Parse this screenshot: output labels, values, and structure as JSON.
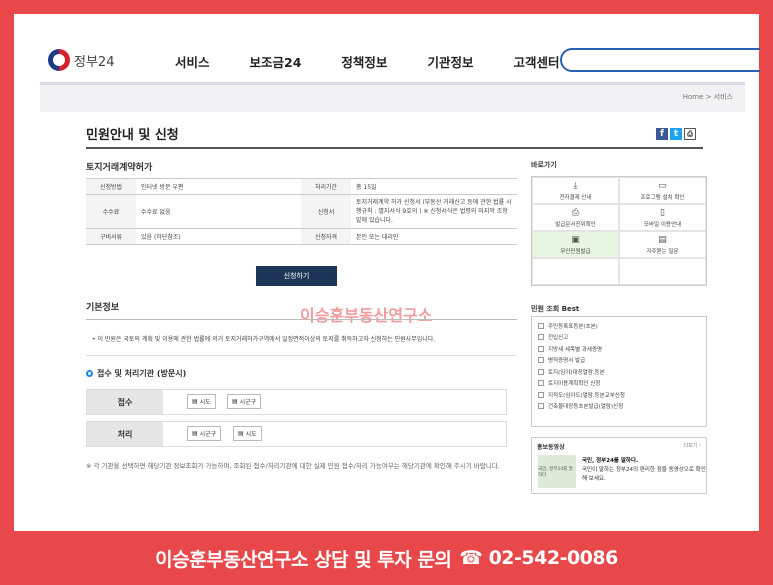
{
  "header": {
    "logo_text": "정부24",
    "nav": [
      "서비스",
      "보조금24",
      "정책정보",
      "기관정보",
      "고객센터"
    ],
    "breadcrumb": "Home > 서비스"
  },
  "page_title": "민원안내 및 신청",
  "social": {
    "fb": "f",
    "tw": "t",
    "print": "⎙"
  },
  "section": {
    "title": "토지거래계약허가",
    "table": [
      {
        "k1": "신청방법",
        "v1": "인터넷 방문 우편",
        "k2": "처리기간",
        "v2": "총 15일"
      },
      {
        "k1": "수수료",
        "v1": "수수료 없음",
        "k2": "신청서",
        "v2": "토지거래계약 허가 신청서 (부동산 거래신고 등에 관한 법률 시행규칙 : 별지서식 9호의 ) ※ 신청서식은 법령의 마지막 조항 밑에 있습니다."
      },
      {
        "k1": "구비서류",
        "v1": "있음 (하단참조)",
        "k2": "신청자격",
        "v2": "본인 또는 대리인"
      }
    ],
    "apply_button": "신청하기"
  },
  "basic_info": {
    "title": "기본정보",
    "text": "이 민원은 국토의 계획 및 이용에 관한 법률에 의거 토지거래허가구역에서 일정면적이상의 토지를 취득하고자 신청하는 민원사무입니다."
  },
  "watermark": "이승훈부동산연구소",
  "office": {
    "title": "접수 및 처리기관 (방문시)",
    "rows": [
      {
        "label": "접수",
        "chips": [
          "시도",
          "시군구"
        ]
      },
      {
        "label": "처리",
        "chips": [
          "시군구",
          "시도"
        ]
      }
    ],
    "note": "※ 각 기관을 선택하면 해당기관 정보조회가 가능하며, 조회된 접수/처리기관에 대한 실제 민원 접수/처리 가능여부는 해당기관에 확인해 주시기 바랍니다."
  },
  "sidebar": {
    "shortcut_title": "바로가기",
    "shortcuts": [
      "전자결제 안내",
      "프로그램 설치 확인",
      "발급문서진위확인",
      "모바일 이용안내",
      "무인민원발급",
      "자주묻는 질문"
    ],
    "best_title": "민원 조회 Best",
    "best": [
      "주민등록표등본(초본)",
      "전입신고",
      "지방세 세목별 과세증명",
      "병적증명서 발급",
      "토지(임야)대장열람.등본",
      "토지이용계획확인 신청",
      "지적도(임야도)열람.등본교부신청",
      "건축물대장등초본발급(열람)신청"
    ],
    "promo_title": "홍보동영상",
    "promo_more": "더보기 ›",
    "promo_head": "국민, 정부24를 말하다.",
    "promo_body": "국민이 말하는 정부24의 편리한 점을 동영상으로 확인해 보세요.",
    "promo_thumb": "국민, 정부24를 말하다"
  },
  "footer": {
    "text": "이승훈부동산연구소 상담 및 투자 문의",
    "phone": "☎ 02-542-0086"
  }
}
